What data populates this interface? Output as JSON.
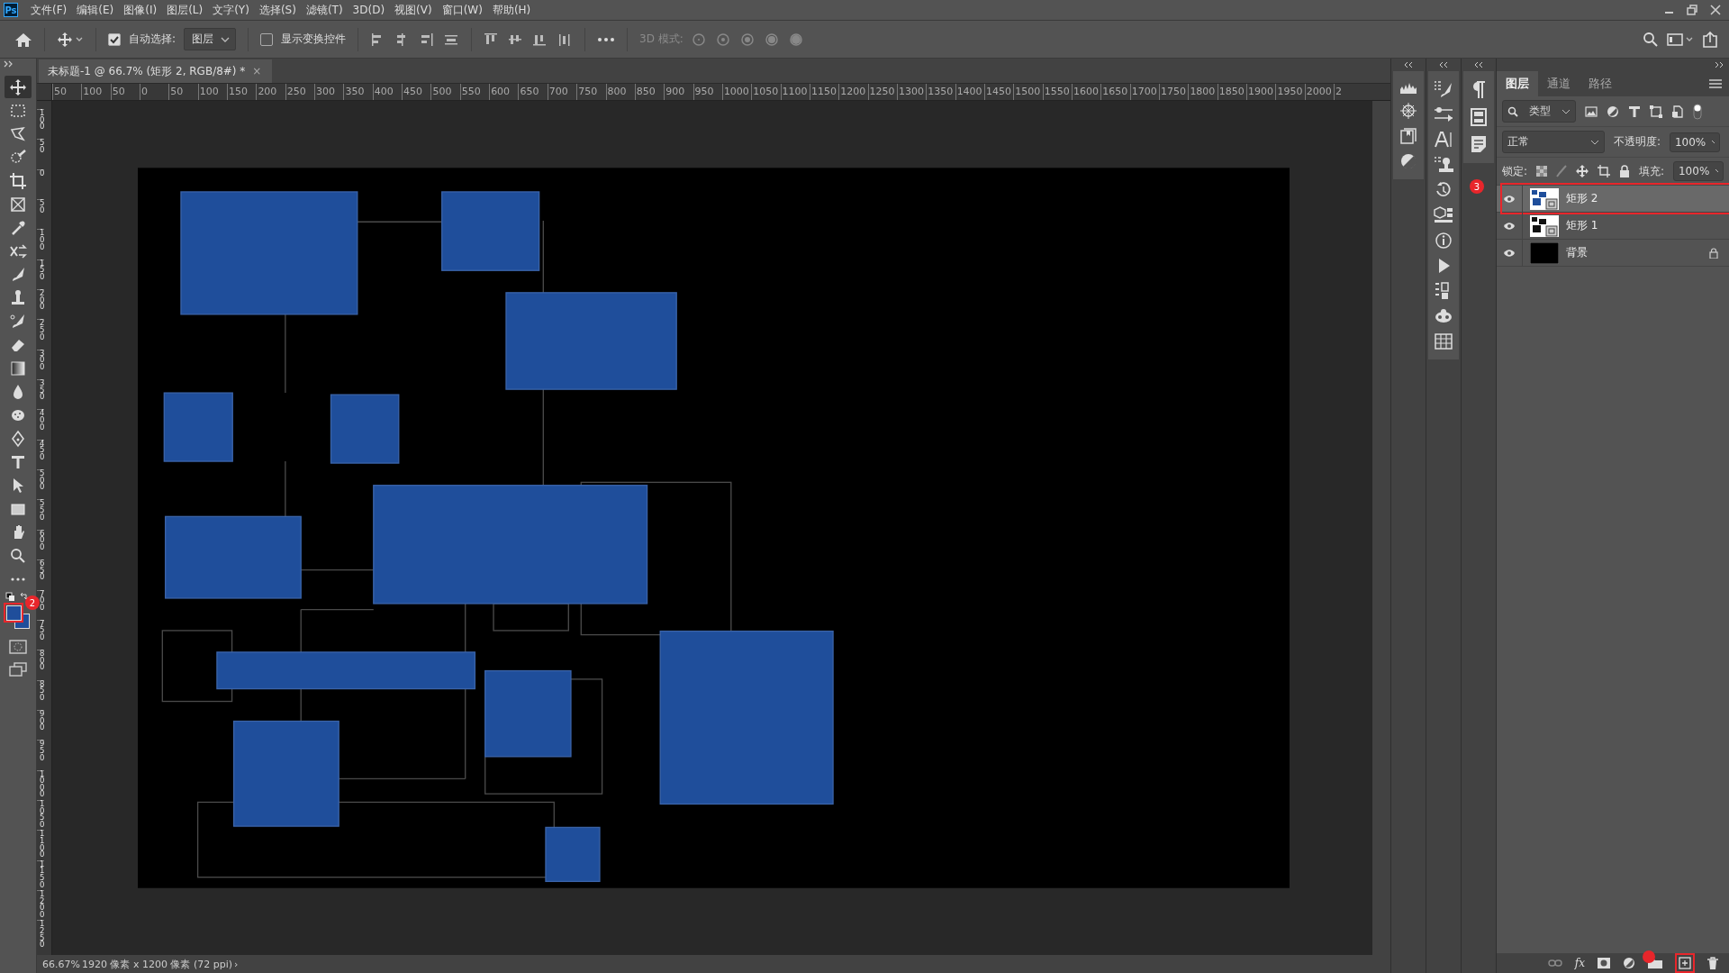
{
  "app": {
    "logo": "Ps"
  },
  "menu": [
    "文件(F)",
    "编辑(E)",
    "图像(I)",
    "图层(L)",
    "文字(Y)",
    "选择(S)",
    "滤镜(T)",
    "3D(D)",
    "视图(V)",
    "窗口(W)",
    "帮助(H)"
  ],
  "options_bar": {
    "auto_select": {
      "label": "自动选择:",
      "checked": true
    },
    "target": "图层",
    "show_transform": {
      "label": "显示变换控件",
      "checked": false
    },
    "mode_3d": "3D 模式:"
  },
  "document_tab": {
    "title": "未标题-1 @ 66.7% (矩形 2, RGB/8#) *",
    "close": "×"
  },
  "ruler": {
    "horizontal": [
      "50",
      "100",
      "50",
      "0",
      "50",
      "100",
      "150",
      "200",
      "250",
      "300",
      "350",
      "400",
      "450",
      "500",
      "550",
      "600",
      "650",
      "700",
      "750",
      "800",
      "850",
      "900",
      "950",
      "1000",
      "1050",
      "1100",
      "1150",
      "1200",
      "1250",
      "1300",
      "1350",
      "1400",
      "1450",
      "1500",
      "1550",
      "1600",
      "1650",
      "1700",
      "1750",
      "1800",
      "1850",
      "1900",
      "1950",
      "2000",
      "2"
    ],
    "vertical": [
      "100",
      "50",
      "0",
      "50",
      "100",
      "150",
      "200",
      "250",
      "300",
      "350",
      "400",
      "450",
      "500",
      "550",
      "600",
      "650",
      "700",
      "750",
      "800",
      "850",
      "900",
      "950",
      "1000",
      "1050",
      "1100",
      "1150",
      "1200",
      "1250"
    ]
  },
  "toolbar": {
    "tools": [
      {
        "kind": "move",
        "selected": true
      },
      {
        "kind": "marquee",
        "selected": false
      },
      {
        "kind": "lasso",
        "selected": false
      },
      {
        "kind": "quick",
        "selected": false
      },
      {
        "kind": "crop",
        "selected": false
      },
      {
        "kind": "frame",
        "selected": false
      },
      {
        "kind": "eyedropper",
        "selected": false
      },
      {
        "kind": "healing",
        "selected": false
      },
      {
        "kind": "brush",
        "selected": false
      },
      {
        "kind": "stamp",
        "selected": false
      },
      {
        "kind": "history",
        "selected": false
      },
      {
        "kind": "eraser",
        "selected": false
      },
      {
        "kind": "gradient",
        "selected": false
      },
      {
        "kind": "blur",
        "selected": false
      },
      {
        "kind": "sponge",
        "selected": false
      },
      {
        "kind": "pen",
        "selected": false
      },
      {
        "kind": "type",
        "selected": false
      },
      {
        "kind": "path",
        "selected": false
      },
      {
        "kind": "rect",
        "selected": false
      },
      {
        "kind": "hand",
        "selected": false
      },
      {
        "kind": "zoom",
        "selected": false
      },
      {
        "kind": "more",
        "selected": false
      }
    ],
    "badge": "2"
  },
  "status_bar": {
    "zoom": "66.67%",
    "info": "1920 像素 x 1200 像素 (72 ppi)",
    "arrow": "›"
  },
  "layers_panel": {
    "tabs": [
      {
        "label": "图层",
        "selected": true
      },
      {
        "label": "通道",
        "selected": false
      },
      {
        "label": "路径",
        "selected": false
      }
    ],
    "filter": "类型",
    "blend_mode": "正常",
    "opacity_label": "不透明度:",
    "opacity": "100%",
    "lock_label": "锁定:",
    "fill_label": "填充:",
    "fill": "100%",
    "layers": [
      {
        "name": "矩形 2",
        "visible": true,
        "selected": true,
        "kind": "shape",
        "locked": false
      },
      {
        "name": "矩形 1",
        "visible": true,
        "selected": false,
        "kind": "shape",
        "locked": false
      },
      {
        "name": "背景",
        "visible": true,
        "selected": false,
        "kind": "fill",
        "locked": true
      }
    ],
    "badge": "3",
    "fx": "fx"
  }
}
